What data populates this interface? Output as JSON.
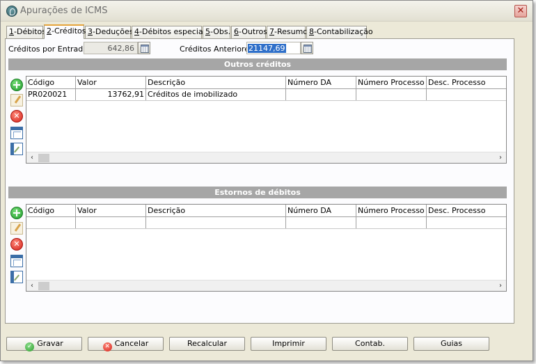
{
  "window": {
    "title": "Apurações de ICMS",
    "close_glyph": "✕"
  },
  "tabs": [
    {
      "key": "1",
      "label": "-Débitos"
    },
    {
      "key": "2",
      "label": "-Créditos"
    },
    {
      "key": "3",
      "label": "-Deduções"
    },
    {
      "key": "4",
      "label": "-Débitos especiais"
    },
    {
      "key": "5",
      "label": "-Obs."
    },
    {
      "key": "6",
      "label": "-Outros"
    },
    {
      "key": "7",
      "label": "-Resumo"
    },
    {
      "key": "8",
      "label": "-Contabilização"
    }
  ],
  "active_tab": "2-Créditos",
  "fields": {
    "creditos_entradas": {
      "label": "Créditos por Entradas",
      "value": "642,86"
    },
    "creditos_anteriores": {
      "label": "Créditos Anteriores",
      "value": "21147,69"
    }
  },
  "outros_creditos": {
    "title": "Outros créditos",
    "columns": [
      "Código",
      "Valor",
      "Descrição",
      "Número DA",
      "Número Processo",
      "Desc. Processo"
    ],
    "rows": [
      {
        "codigo": "PR020021",
        "valor": "13762,91",
        "descricao": "Créditos de imobilizado",
        "numero_da": "",
        "numero_processo": "",
        "desc_processo": ""
      }
    ]
  },
  "estornos_debitos": {
    "title": "Estornos de débitos",
    "columns": [
      "Código",
      "Valor",
      "Descrição",
      "Número DA",
      "Número Processo",
      "Desc. Processo"
    ],
    "rows": []
  },
  "side_icons": [
    "add-icon",
    "edit-icon",
    "delete-icon",
    "table-config-icon",
    "export-icon"
  ],
  "buttons": {
    "gravar": "Gravar",
    "cancelar": "Cancelar",
    "recalcular": "Recalcular",
    "imprimir": "Imprimir",
    "contab": "Contab.",
    "guias": "Guias"
  },
  "colors": {
    "section_header": "#a6a6a6",
    "selection": "#2f6fc9",
    "active_tab_accent": "#e5a33a"
  }
}
